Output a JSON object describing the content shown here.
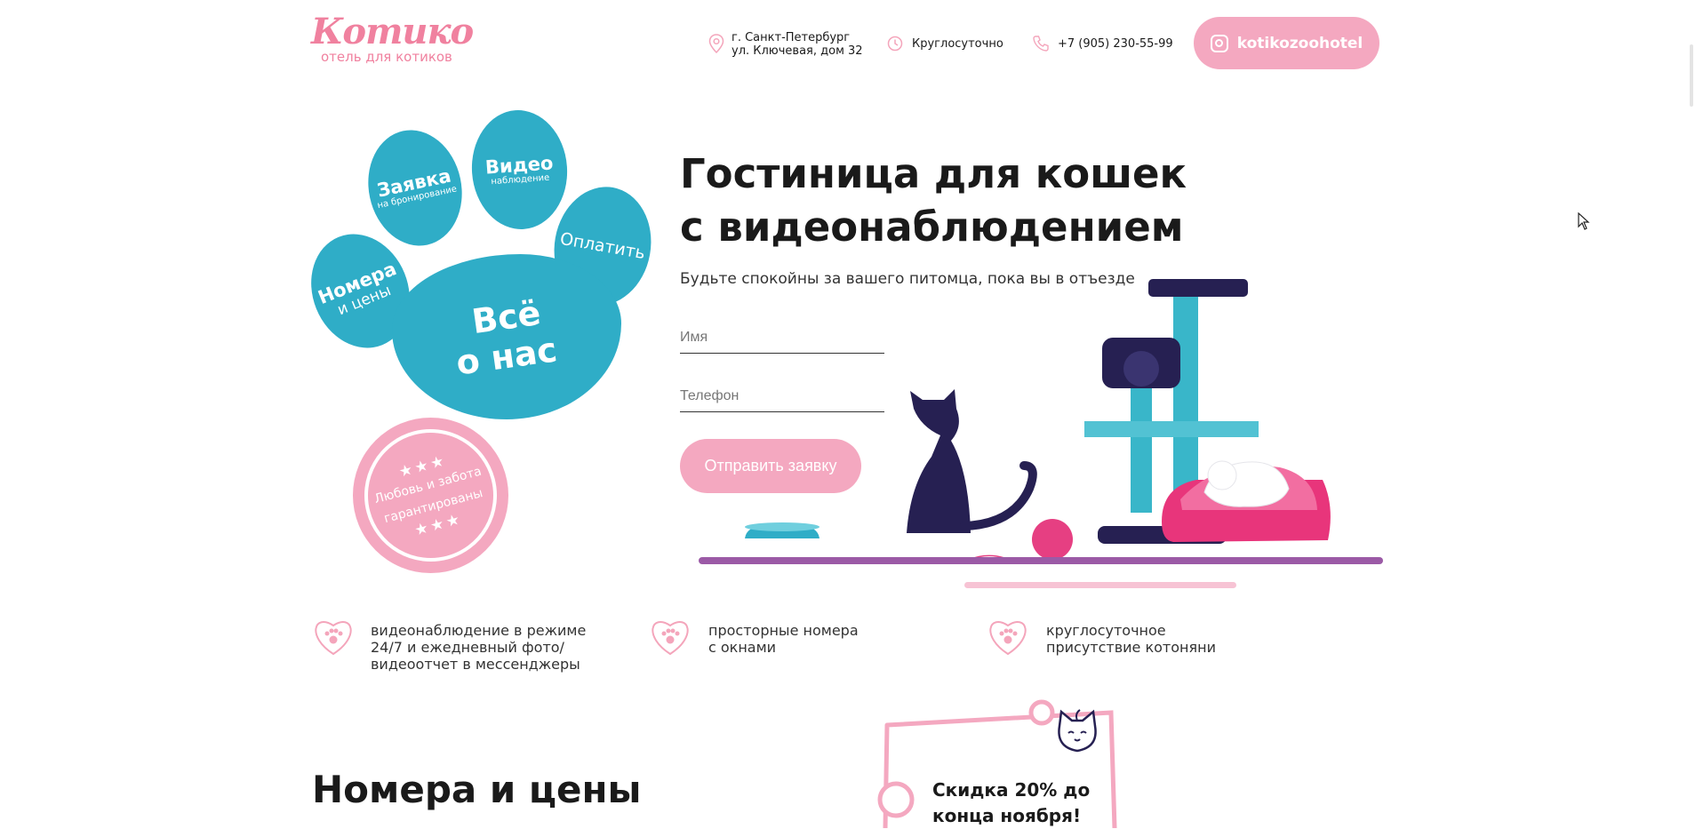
{
  "header": {
    "logo_title": "Котико",
    "logo_subtitle": "отель для котиков",
    "address_line1": "г. Санкт-Петербург",
    "address_line2": "ул. Ключевая, дом 32",
    "hours": "Круглосуточно",
    "phone": "+7 (905) 230-55-99",
    "instagram": "kotikozoohotel"
  },
  "paw_nav": {
    "booking": "Заявка",
    "booking_sub": "на бронирование",
    "video": "Видео",
    "video_sub": "наблюдение",
    "pay": "Оплатить",
    "rooms_line1": "Номера",
    "rooms_line2": "и цены",
    "about_line1": "Всё",
    "about_line2": "о нас"
  },
  "seal": {
    "stars_top": "★★★",
    "line1": "Любовь и забота",
    "line2": "гарантированы",
    "stars_bottom": "★★★"
  },
  "hero": {
    "title_line1": "Гостиница для кошек",
    "title_line2": "с видеонаблюдением",
    "subtitle": "Будьте спокойны за вашего питомца, пока вы в отъезде",
    "name_placeholder": "Имя",
    "phone_placeholder": "Телефон",
    "submit_label": "Отправить заявку"
  },
  "features": [
    {
      "line1": "видеонаблюдение в режиме",
      "line2": "24/7 и ежедневный фото/",
      "line3": "видеоотчет в мессенджеры"
    },
    {
      "line1": "просторные номера",
      "line2": "с окнами",
      "line3": ""
    },
    {
      "line1": "круглосуточное",
      "line2": "присутствие котоняни",
      "line3": ""
    }
  ],
  "rooms_heading": "Номера и цены",
  "promo": {
    "line1": "Скидка 20% до",
    "line2": "конца ноября!"
  },
  "colors": {
    "pink": "#f4a8c0",
    "teal": "#2fadc7",
    "navy": "#262052"
  }
}
